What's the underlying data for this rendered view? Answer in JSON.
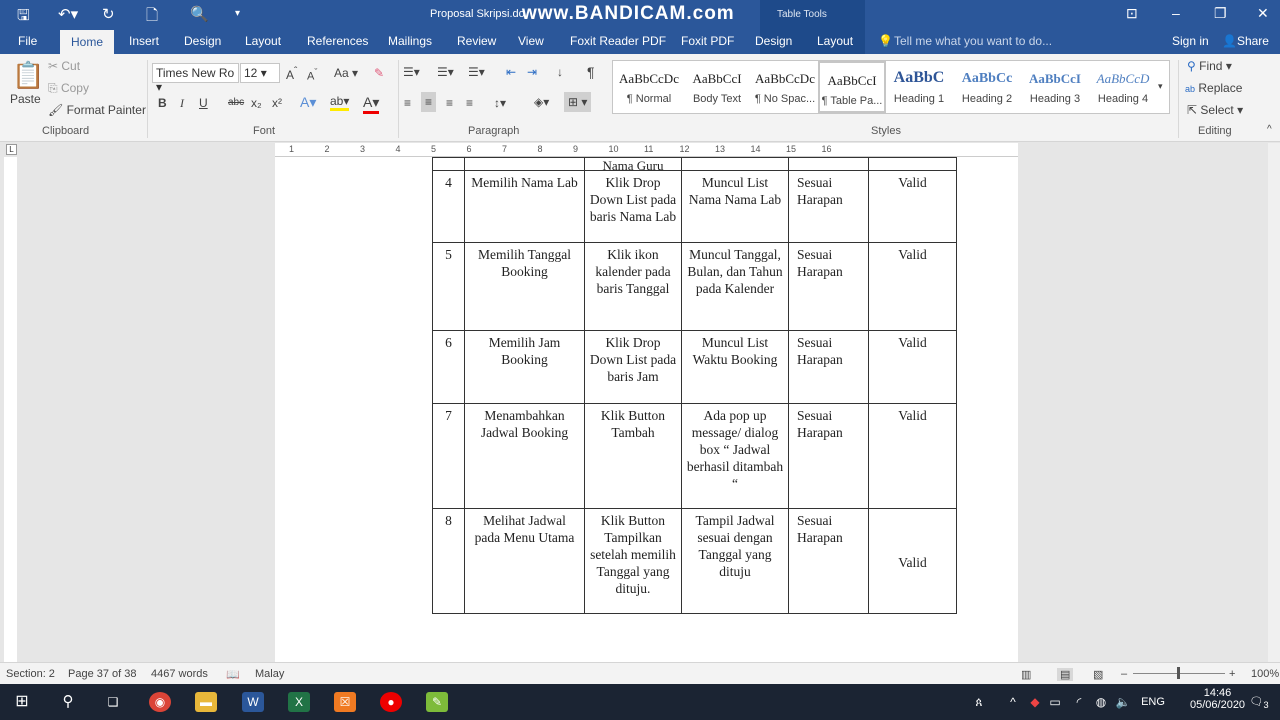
{
  "app": {
    "title": "Proposal Skripsi.do",
    "watermark": "www.BANDICAM.com",
    "context_tab": "Table Tools"
  },
  "tabs": [
    "File",
    "Home",
    "Insert",
    "Design",
    "Layout",
    "References",
    "Mailings",
    "Review",
    "View",
    "Foxit Reader PDF",
    "Foxit PDF",
    "Design",
    "Layout"
  ],
  "tell_me": "Tell me what you want to do...",
  "sign_in": "Sign in",
  "share": "Share",
  "clipboard": {
    "paste": "Paste",
    "cut": "Cut",
    "copy": "Copy",
    "format_painter": "Format Painter",
    "label": "Clipboard"
  },
  "font": {
    "name": "Times New Ro",
    "size": "12",
    "label": "Font",
    "bold": "B",
    "italic": "I",
    "underline": "U",
    "strike": "abc",
    "sub": "x₂",
    "sup": "x²",
    "case": "Aa"
  },
  "paragraph": {
    "label": "Paragraph",
    "pilcrow": "¶"
  },
  "styles": {
    "label": "Styles",
    "items": [
      {
        "preview": "AaBbCcDc",
        "name": "¶ Normal"
      },
      {
        "preview": "AaBbCcI",
        "name": "Body Text"
      },
      {
        "preview": "AaBbCcDc",
        "name": "¶ No Spac..."
      },
      {
        "preview": "AaBbCcI",
        "name": "¶ Table Pa..."
      },
      {
        "preview": "AaBbC",
        "name": "Heading 1"
      },
      {
        "preview": "AaBbCc",
        "name": "Heading 2"
      },
      {
        "preview": "AaBbCcI",
        "name": "Heading 3"
      },
      {
        "preview": "AaBbCcD",
        "name": "Heading 4"
      }
    ]
  },
  "editing": {
    "find": "Find",
    "replace": "Replace",
    "select": "Select",
    "label": "Editing"
  },
  "ruler": [
    "1",
    "2",
    "3",
    "4",
    "5",
    "6",
    "7",
    "8",
    "9",
    "10",
    "11",
    "12",
    "13",
    "14",
    "15",
    "16"
  ],
  "table": {
    "partial_row": "Nama Guru",
    "rows": [
      [
        "4",
        "Memilih Nama Lab",
        "Klik Drop Down List pada baris Nama Lab",
        "Muncul List Nama Nama Lab",
        "Sesuai Harapan",
        "Valid"
      ],
      [
        "5",
        "Memilih Tanggal Booking",
        "Klik ikon kalender pada baris Tanggal",
        "Muncul Tanggal, Bulan, dan Tahun pada Kalender",
        "Sesuai Harapan",
        "Valid"
      ],
      [
        "6",
        "Memilih Jam Booking",
        "Klik Drop Down List pada baris Jam",
        "Muncul List Waktu Booking",
        "Sesuai Harapan",
        "Valid"
      ],
      [
        "7",
        "Menambahkan Jadwal Booking",
        "Klik Button Tambah",
        "Ada pop up message/ dialog box “ Jadwal berhasil ditambah “",
        "Sesuai Harapan",
        "Valid"
      ],
      [
        "8",
        "Melihat Jadwal pada Menu Utama",
        "Klik Button Tampilkan setelah memilih Tanggal yang dituju.",
        "Tampil Jadwal sesuai dengan Tanggal yang dituju",
        "Sesuai Harapan",
        "Valid"
      ]
    ]
  },
  "status": {
    "section": "Section: 2",
    "page": "Page 37 of 38",
    "words": "4467 words",
    "language": "Malay",
    "zoom": "100%"
  },
  "taskbar": {
    "lang": "ENG",
    "time": "14:46",
    "date": "05/06/2020",
    "notifications": "3"
  },
  "colors": {
    "word_blue": "#2b579a",
    "taskbar": "#1b2433"
  }
}
